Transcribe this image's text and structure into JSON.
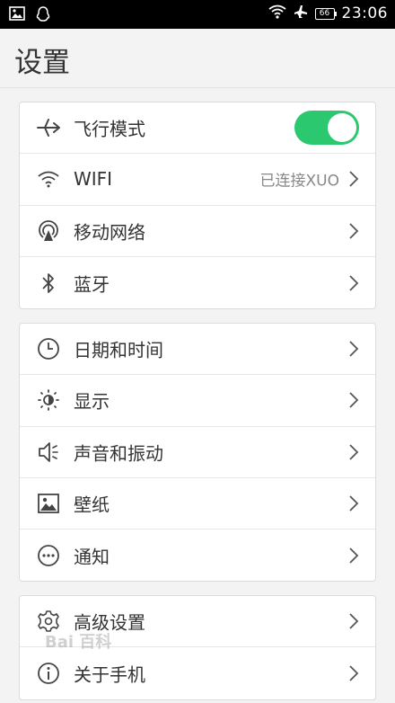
{
  "status_bar": {
    "time": "23:06",
    "battery": "66",
    "icons": [
      "image-icon",
      "qq-icon",
      "wifi-icon",
      "airplane-icon",
      "battery-icon"
    ]
  },
  "header": {
    "title": "设置"
  },
  "groups": [
    {
      "items": [
        {
          "icon": "airplane-icon",
          "label": "飞行模式",
          "toggle": true
        },
        {
          "icon": "wifi-icon",
          "label": "WIFI",
          "value": "已连接XUO"
        },
        {
          "icon": "mobile-network-icon",
          "label": "移动网络"
        },
        {
          "icon": "bluetooth-icon",
          "label": "蓝牙"
        }
      ]
    },
    {
      "items": [
        {
          "icon": "clock-icon",
          "label": "日期和时间"
        },
        {
          "icon": "brightness-icon",
          "label": "显示"
        },
        {
          "icon": "sound-icon",
          "label": "声音和振动"
        },
        {
          "icon": "wallpaper-icon",
          "label": "壁纸"
        },
        {
          "icon": "notification-icon",
          "label": "通知"
        }
      ]
    },
    {
      "items": [
        {
          "icon": "gear-icon",
          "label": "高级设置"
        },
        {
          "icon": "info-icon",
          "label": "关于手机"
        }
      ]
    }
  ],
  "colors": {
    "accent": "#2bc86f",
    "background": "#f3f3f3"
  },
  "watermark": "Bai 百科"
}
